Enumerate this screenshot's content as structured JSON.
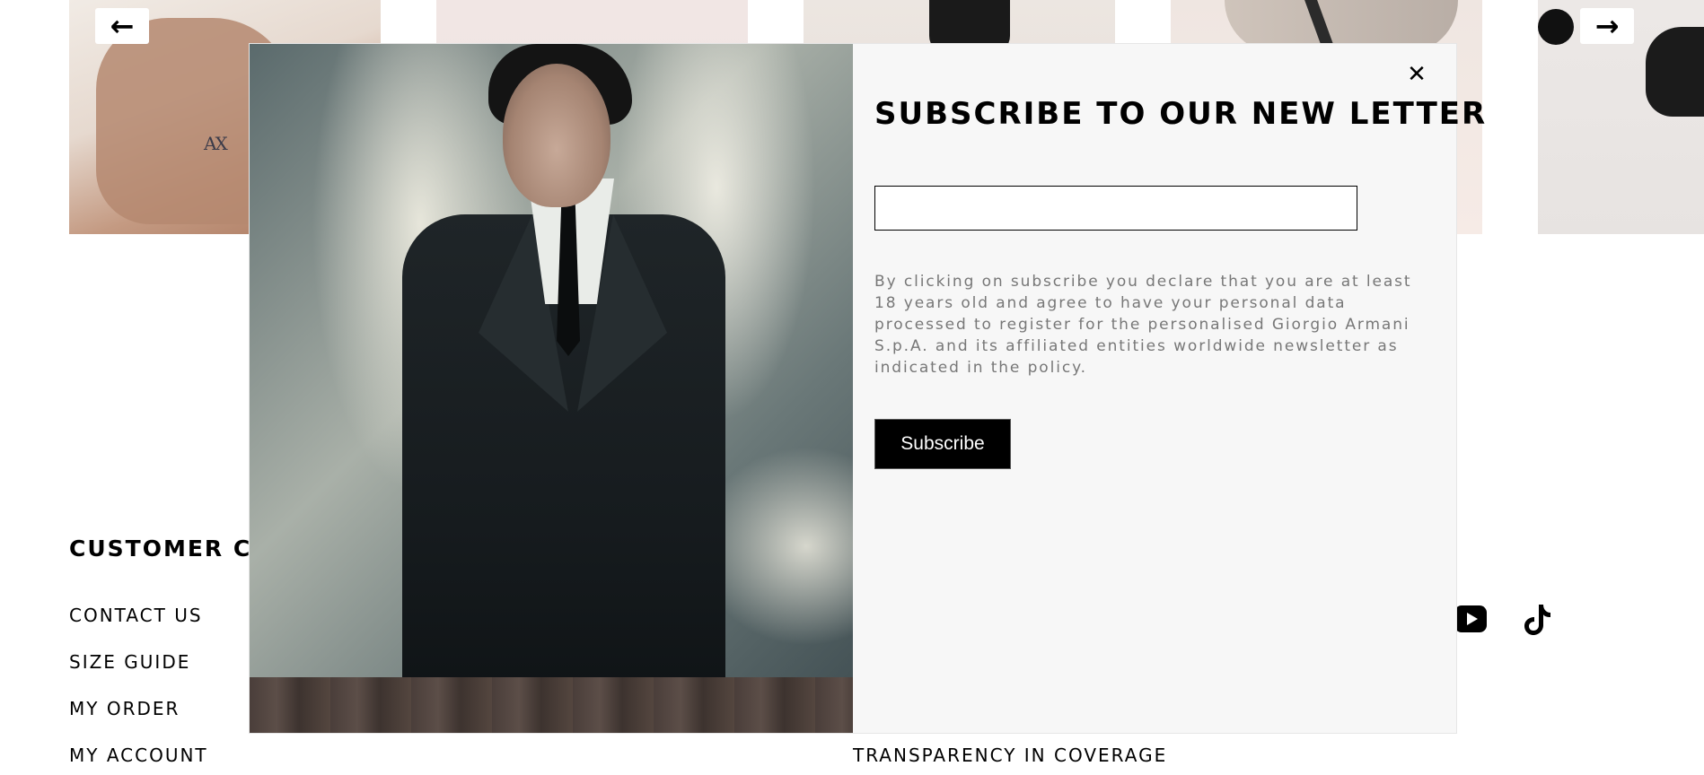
{
  "carousel": {
    "prev_icon": "arrow-left-icon",
    "prev_glyph": "←",
    "next_icon": "arrow-right-icon",
    "next_glyph": "→",
    "tile_logo": "AX"
  },
  "footer": {
    "heading": "CUSTOMER CA",
    "links": [
      "CONTACT US",
      "SIZE GUIDE",
      "MY ORDER",
      "MY ACCOUNT"
    ],
    "links_col2": [
      "TRANSPARENCY IN COVERAGE"
    ],
    "social_icons": [
      "youtube-icon",
      "tiktok-icon"
    ]
  },
  "modal": {
    "close_glyph": "✕",
    "close_icon": "close-icon",
    "title": "SUBSCRIBE TO OUR NEW LETTER",
    "email_placeholder": "",
    "disclaimer": "By clicking on subscribe you declare that you are at least 18 years old and agree to have your personal data processed to register for the personalised Giorgio Armani S.p.A. and its affiliated entities worldwide newsletter as indicated in the policy.",
    "subscribe_label": "Subscribe"
  },
  "colors": {
    "panel_bg": "#f7f7f7",
    "button_bg": "#000000",
    "button_text": "#ffffff",
    "disclaimer_text": "#777777"
  }
}
